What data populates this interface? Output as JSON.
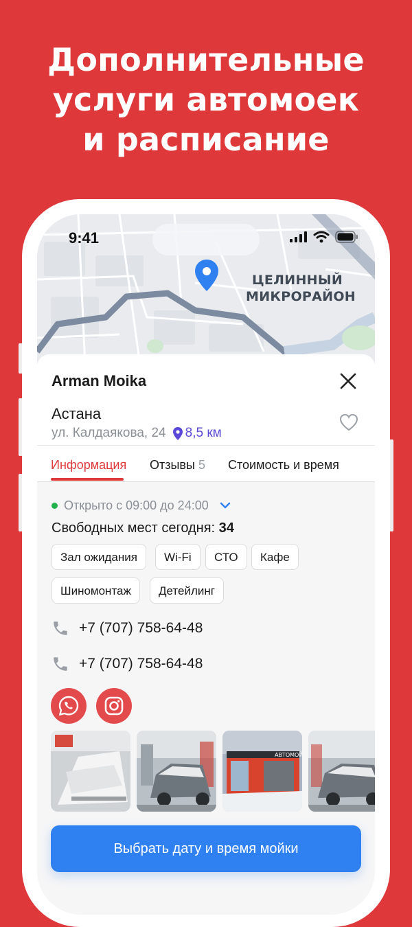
{
  "promo": {
    "line1": "Дополнительные",
    "line2": "услуги автомоек",
    "line3": "и расписание"
  },
  "status_bar": {
    "time": "9:41"
  },
  "map": {
    "label_line1": "ЦЕЛИННЫЙ",
    "label_line2": "МИКРОРАЙОН"
  },
  "place": {
    "name": "Arman Moika",
    "city": "Астана",
    "address": "ул. Калдаякова, 24",
    "distance": "8,5 км"
  },
  "tabs": [
    {
      "label": "Информация"
    },
    {
      "label": "Отзывы",
      "count": "5"
    },
    {
      "label": "Стоимость и время"
    }
  ],
  "info": {
    "open_hours": "Открыто с 09:00 до 24:00",
    "free_label": "Свободных мест сегодня:",
    "free_value": "34"
  },
  "services": [
    "Зал ожидания",
    "Wi-Fi",
    "СТО",
    "Кафе",
    "Шиномонтаж",
    "Детейлинг"
  ],
  "phones": [
    "+7 (707) 758-64-48",
    "+7 (707) 758-64-48"
  ],
  "social": [
    "whatsapp-icon",
    "instagram-icon"
  ],
  "cta": {
    "label": "Выбрать дату и время мойки"
  },
  "colors": {
    "brand_red": "#df383a",
    "accent_blue": "#2f80f0",
    "distance_purple": "#5a49d8",
    "open_green": "#22b14c"
  }
}
